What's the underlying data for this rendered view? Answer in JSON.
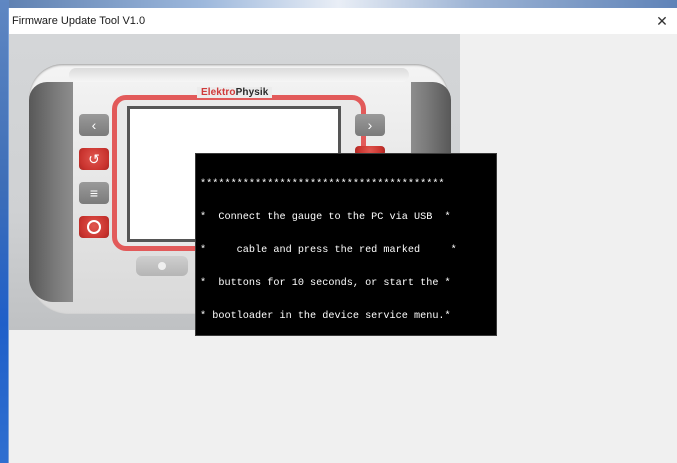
{
  "window": {
    "title": "Firmware Update Tool V1.0",
    "close_glyph": "✕"
  },
  "device": {
    "brand_part1": "Elektro",
    "brand_part2": "Physik",
    "buttons": {
      "left_arrow": "‹",
      "right_arrow": "›",
      "back": "↺",
      "menu": "≡"
    }
  },
  "console": {
    "lines": [
      "****************************************",
      "*  Connect the gauge to the PC via USB  *",
      "*     cable and press the red marked     *",
      "*  buttons for 10 seconds, or start the *",
      "* bootloader in the device service menu.*",
      "****************************************"
    ]
  },
  "colors": {
    "accent_red": "#e25a5a",
    "console_bg": "#000000",
    "console_fg": "#ffffff"
  }
}
